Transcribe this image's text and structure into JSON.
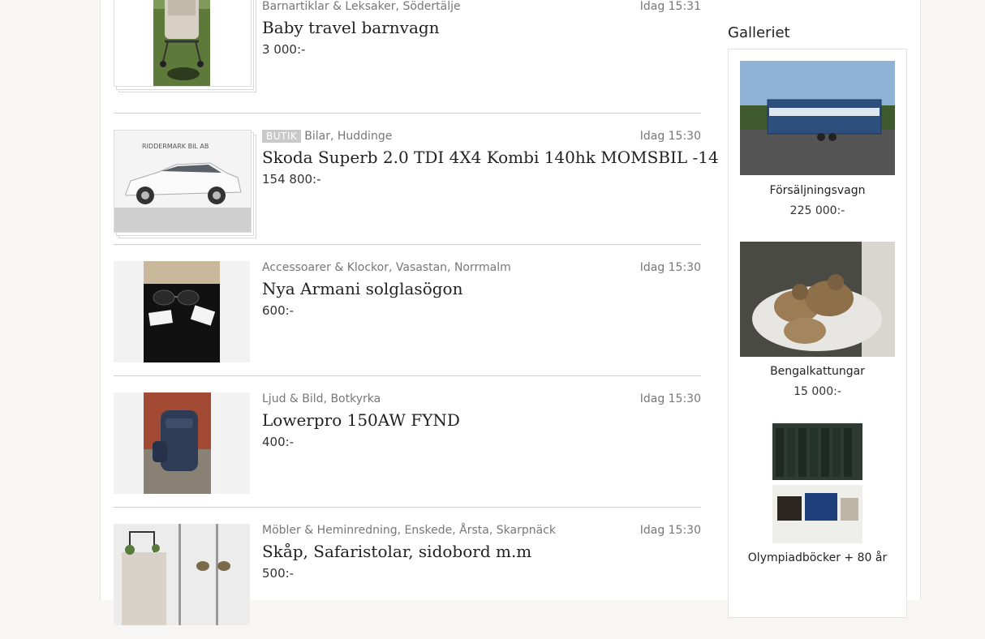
{
  "listings": [
    {
      "meta": "Barnartiklar & Leksaker, Södertälje",
      "badge": "",
      "time": "Idag 15:31",
      "title": "Baby travel barnvagn",
      "price": "3 000:-",
      "image_icon": "stroller-photo"
    },
    {
      "meta": "Bilar, Huddinge",
      "badge": "BUTIK",
      "time": "Idag 15:30",
      "title": "Skoda Superb 2.0 TDI 4X4 Kombi 140hk MOMSBIL -14",
      "price": "154 800:-",
      "image_icon": "car-photo"
    },
    {
      "meta": "Accessoarer & Klockor, Vasastan, Norrmalm",
      "badge": "",
      "time": "Idag 15:30",
      "title": "Nya Armani solglasögon",
      "price": "600:-",
      "image_icon": "sunglasses-photo"
    },
    {
      "meta": "Ljud & Bild, Botkyrka",
      "badge": "",
      "time": "Idag 15:30",
      "title": "Lowerpro 150AW FYND",
      "price": "400:-",
      "image_icon": "backpack-photo"
    },
    {
      "meta": "Möbler & Heminredning, Enskede, Årsta, Skarpnäck",
      "badge": "",
      "time": "Idag 15:30",
      "title": "Skåp, Safaristolar, sidobord m.m",
      "price": "500:-",
      "image_icon": "furniture-photo"
    }
  ],
  "sidebar": {
    "title": "Galleriet",
    "items": [
      {
        "name": "Försäljningsvagn",
        "price": "225 000:-"
      },
      {
        "name": "Bengalkattungar",
        "price": "15 000:-"
      },
      {
        "name": "Olympiadböcker + 80 år",
        "price": ""
      }
    ]
  },
  "brand_text": "RIDDERMARK BIL AB"
}
